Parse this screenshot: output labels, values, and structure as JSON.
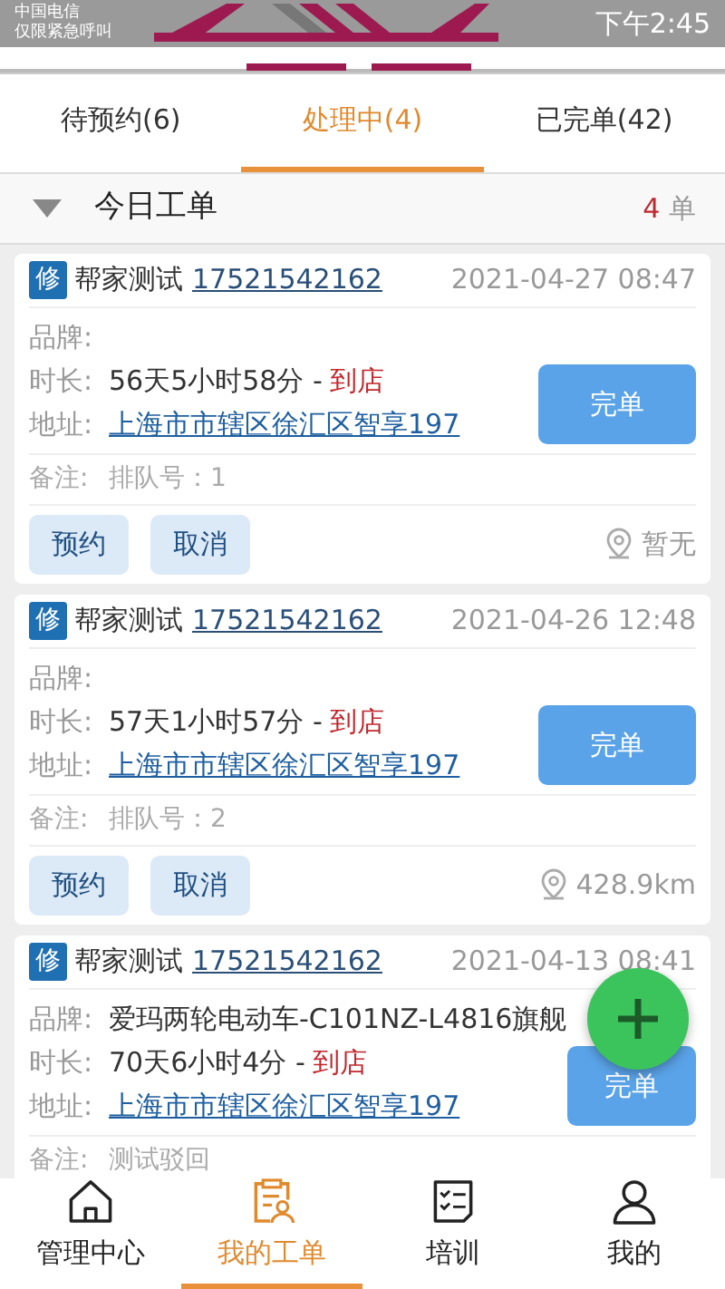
{
  "status_bar": {
    "carrier": "中国电信",
    "carrier_note": "仅限紧急呼叫",
    "time": "下午2:45"
  },
  "tabs": [
    {
      "label": "待预约(6)",
      "selected": false
    },
    {
      "label": "处理中(4)",
      "selected": true
    },
    {
      "label": "已完单(42)",
      "selected": false
    }
  ],
  "section": {
    "title": "今日工单",
    "count": "4",
    "unit": "单",
    "expanded": true
  },
  "orders": [
    {
      "tag": "修",
      "name": "帮家测试",
      "phone": "17521542162",
      "date": "2021-04-27 08:47",
      "brand_label": "品牌:",
      "duration_label": "时长:",
      "duration": "56天5小时58分 -",
      "status": "到店",
      "address_label": "地址:",
      "address": "上海市市辖区徐汇区智享197",
      "complete": "完单",
      "remark_label": "备注:",
      "remark": "排队号：1",
      "actions": [
        "预约",
        "取消"
      ],
      "distance": "暂无"
    },
    {
      "tag": "修",
      "name": "帮家测试",
      "phone": "17521542162",
      "date": "2021-04-26 12:48",
      "brand_label": "品牌:",
      "duration_label": "时长:",
      "duration": "57天1小时57分 -",
      "status": "到店",
      "address_label": "地址:",
      "address": "上海市市辖区徐汇区智享197",
      "complete": "完单",
      "remark_label": "备注:",
      "remark": "排队号：2",
      "actions": [
        "预约",
        "取消"
      ],
      "distance": "428.9km"
    },
    {
      "tag": "修",
      "name": "帮家测试",
      "phone": "17521542162",
      "date": "2021-04-13 08:41",
      "brand_label": "品牌:",
      "brand": "爱玛两轮电动车-C101NZ-L4816旗舰",
      "duration_label": "时长:",
      "duration": "70天6小时4分 -",
      "status": "到店",
      "address_label": "地址:",
      "address": "上海市市辖区徐汇区智享197",
      "complete": "完单",
      "remark_label": "备注:",
      "remark": "测试驳回"
    }
  ],
  "nav": [
    {
      "label": "管理中心",
      "selected": false
    },
    {
      "label": "我的工单",
      "selected": true
    },
    {
      "label": "培训",
      "selected": false
    },
    {
      "label": "我的",
      "selected": false
    }
  ]
}
